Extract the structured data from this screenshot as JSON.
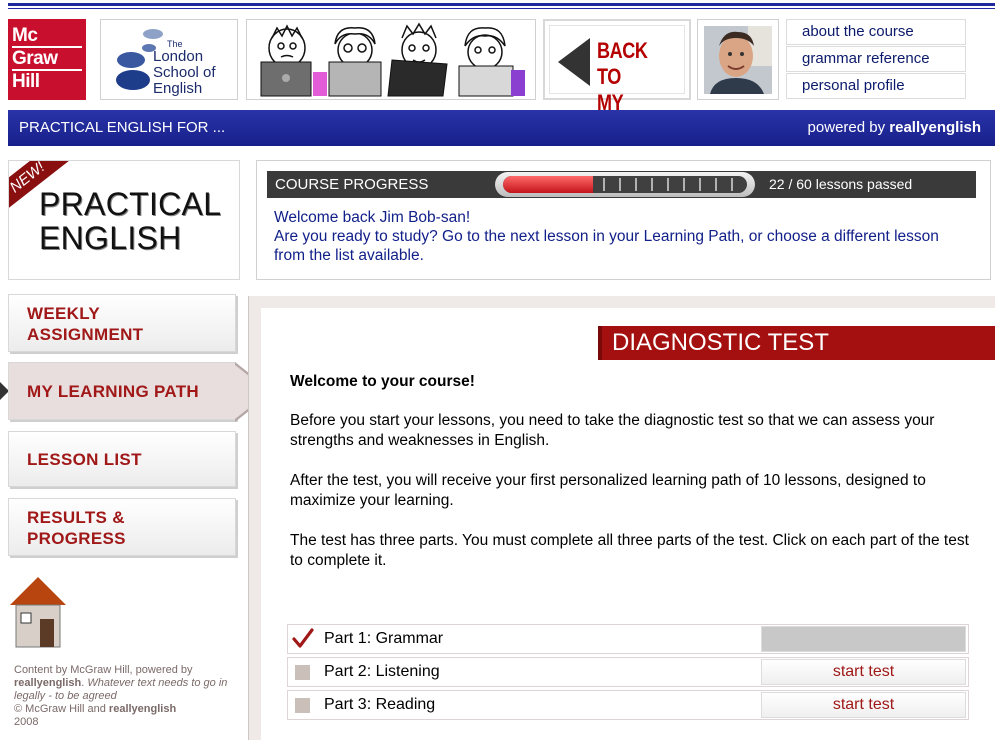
{
  "header": {
    "logo_lines": [
      "Mc",
      "Graw",
      "Hill"
    ],
    "school": {
      "the": "The",
      "line1": "London",
      "line2": "School of",
      "line3": "English"
    },
    "back_button": {
      "line1": "BACK TO",
      "line2": "MY PAGE"
    },
    "menu": [
      "about the course",
      "grammar reference",
      "personal profile"
    ]
  },
  "bluebar": {
    "title": "PRACTICAL ENGLISH FOR ...",
    "powered_prefix": "powered by",
    "powered_brand": "reallyenglish"
  },
  "course": {
    "badge": "NEW!",
    "title_line1": "PRACTICAL",
    "title_line2": "ENGLISH"
  },
  "progress": {
    "label": "COURSE PROGRESS",
    "passed": 22,
    "total": 60,
    "text": "22 / 60 lessons passed",
    "welcome_line1": "Welcome back Jim Bob-san!",
    "welcome_line2": "Are you ready to study? Go to the next lesson in your Learning Path, or choose a different lesson from the list available."
  },
  "nav": {
    "weekly_line1": "WEEKLY",
    "weekly_line2": "ASSIGNMENT",
    "learning_path": "MY LEARNING PATH",
    "lesson_list": "LESSON LIST",
    "results_line1": "RESULTS &",
    "results_line2": "PROGRESS"
  },
  "credit": {
    "line1": "Content by McGraw Hill, powered by",
    "brand": "reallyenglish",
    "note": "Whatever text needs to go in legally - to be agreed",
    "copyright_prefix": "© McGraw Hill and",
    "copyright_brand": "reallyenglish",
    "year": "2008"
  },
  "diagnostic": {
    "title": "DIAGNOSTIC TEST",
    "welcome": "Welcome to your course!",
    "para1": "Before you start your lessons, you need to take the diagnostic test so that we can assess your strengths and weaknesses in English.",
    "para2": "After the test, you will receive your first personalized learning path of 10 lessons, designed to maximize your learning.",
    "para3": "The test has three parts. You must complete all three parts of the test. Click on each part of the test to complete it.",
    "parts": [
      {
        "label": "Part 1: Grammar",
        "completed": true,
        "button": ""
      },
      {
        "label": "Part 2: Listening",
        "completed": false,
        "button": "start test"
      },
      {
        "label": "Part 3: Reading",
        "completed": false,
        "button": "start test"
      }
    ]
  },
  "colors": {
    "navy": "#1f2a9c",
    "brand_red": "#c8102e",
    "dark_red": "#a40f0f",
    "progress_red": "#c4141a"
  }
}
